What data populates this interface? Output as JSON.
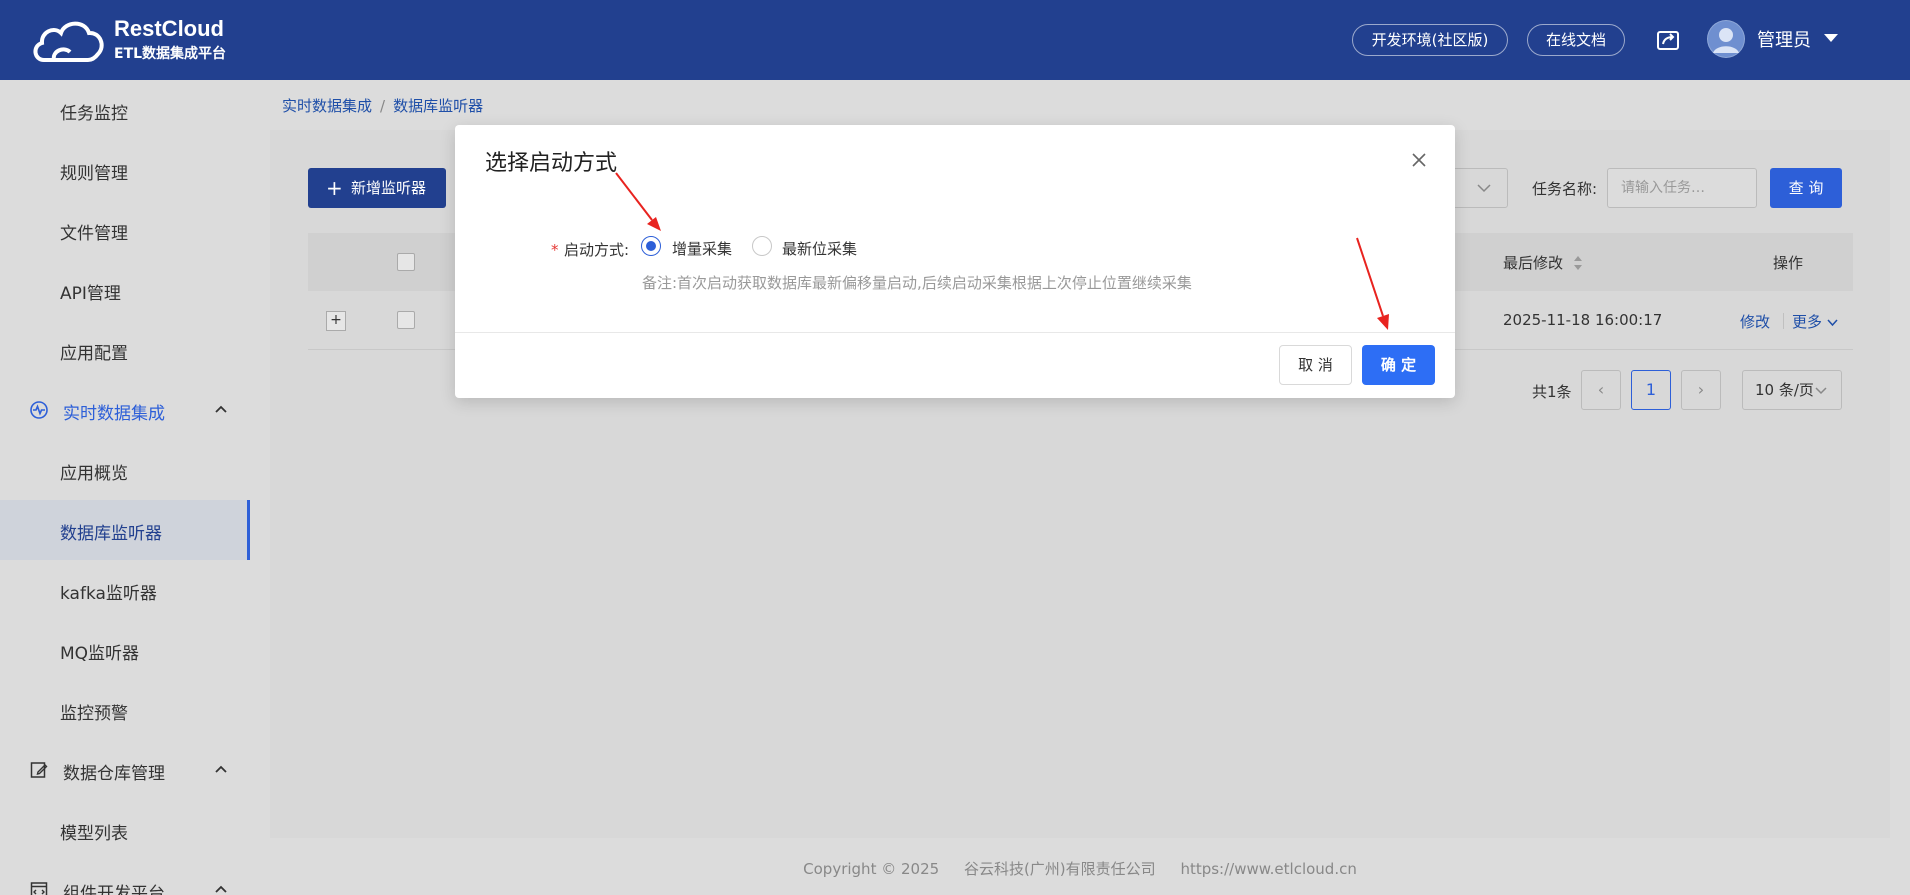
{
  "header": {
    "brand": "RestCloud",
    "brand_sub": "ETL数据集成平台",
    "env_button": "开发环境(社区版)",
    "docs_button": "在线文档",
    "user_name": "管理员"
  },
  "sidebar": {
    "items": [
      {
        "label": "任务监控"
      },
      {
        "label": "规则管理"
      },
      {
        "label": "文件管理"
      },
      {
        "label": "API管理"
      },
      {
        "label": "应用配置"
      },
      {
        "label": "实时数据集成"
      },
      {
        "label": "应用概览"
      },
      {
        "label": "数据库监听器"
      },
      {
        "label": "kafka监听器"
      },
      {
        "label": "MQ监听器"
      },
      {
        "label": "监控预警"
      },
      {
        "label": "数据仓库管理"
      },
      {
        "label": "模型列表"
      },
      {
        "label": "组件开发平台"
      }
    ]
  },
  "breadcrumb": {
    "first": "实时数据集成",
    "sep": "/",
    "second": "数据库监听器"
  },
  "toolbar": {
    "new_button": "新增监听器",
    "task_label": "任务名称:",
    "task_placeholder": "请输入任务…",
    "query_button": "查 询"
  },
  "table": {
    "headers": {
      "last_modified": "最后修改",
      "actions": "操作"
    },
    "rows": [
      {
        "expand": "+",
        "last_modified": "2025-11-18 16:00:17",
        "edit": "修改",
        "more": "更多"
      }
    ]
  },
  "pager": {
    "total": "共1条",
    "current": "1",
    "page_size": "10 条/页"
  },
  "footer": {
    "copyright": "Copyright © 2025",
    "company": "谷云科技(广州)有限责任公司",
    "url": "https://www.etlcloud.cn"
  },
  "modal": {
    "title": "选择启动方式",
    "field_label": "启动方式:",
    "required_mark": "*",
    "options": [
      {
        "label": "增量采集",
        "checked": true
      },
      {
        "label": "最新位采集",
        "checked": false
      }
    ],
    "note": "备注:首次启动获取数据库最新偏移量启动,后续启动采集根据上次停止位置继续采集",
    "cancel_button": "取 消",
    "ok_button": "确 定"
  },
  "colors": {
    "header_bg": "#22408f",
    "primary": "#2d6ef5",
    "annotation_arrow": "#e8231f"
  }
}
